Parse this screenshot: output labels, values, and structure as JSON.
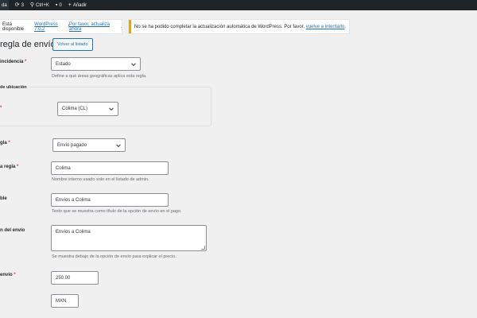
{
  "adminbar": {
    "site_label": "da",
    "updates_count": "3",
    "search_label": "Ctrl+K",
    "comments_count": "0",
    "new_label": "Añadir"
  },
  "notices": {
    "update_text": "Está disponible",
    "update_link": "WordPress 7.0.2",
    "update_mid": "! ",
    "update_link2": "Por favor, actualiza ahora",
    "update_end": ".",
    "autoupdate_text": "No se ha podido completar la actualización automática de WordPress. Por favor,",
    "autoupdate_link": "vuelve a intentarlo",
    "autoupdate_end": "."
  },
  "page": {
    "title": "regla de envío",
    "back_button": "Volver al listado"
  },
  "form": {
    "match_label": "incidencia",
    "match_value": "Estado",
    "match_help": "Define a qué áreas geográficas aplica esta regla.",
    "location_legend": "de ubicación",
    "state_value": "Colima (CL)",
    "type_label": "gla",
    "type_value": "Envío pagado",
    "name_label": "a regla",
    "name_value": "Colima",
    "name_help": "Nombre interno usado solo en el listado de admin.",
    "title_label": "ble",
    "title_value": "Envíos a Colima",
    "title_help": "Texto que se muestra como título de la opción de envío en el pago.",
    "desc_label": "n del envío",
    "desc_value": "Envíos a Colima",
    "desc_help": "Se muestra debajo de la opción de envío para explicar el precio.",
    "cost_label": "envío",
    "cost_value": "250.00",
    "currency_value": "MXN",
    "required_mark": "*"
  }
}
